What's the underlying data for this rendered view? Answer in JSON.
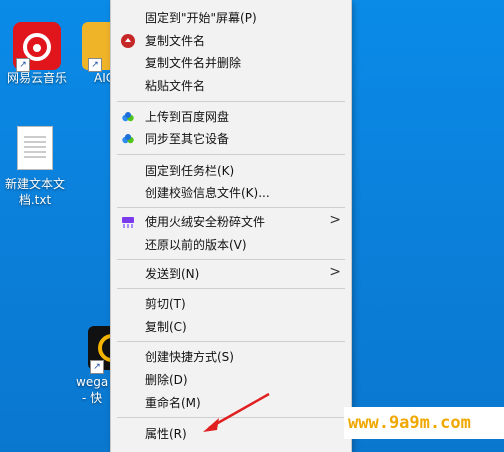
{
  "desktop": {
    "icons": [
      {
        "label": "网易云音乐"
      },
      {
        "label": "AIC"
      },
      {
        "label_line1": "新建文本文",
        "label_line2": "档.txt"
      },
      {
        "label_line1": "wega",
        "label_line2": "- 快"
      }
    ]
  },
  "context_menu": {
    "items": [
      {
        "label": "固定到\"开始\"屏幕(P)"
      },
      {
        "label": "复制文件名",
        "icon": "red-copy-icon"
      },
      {
        "label": "复制文件名并删除"
      },
      {
        "label": "粘贴文件名"
      },
      {
        "label": "上传到百度网盘",
        "icon": "baidu-cloud-icon"
      },
      {
        "label": "同步至其它设备",
        "icon": "baidu-cloud-icon"
      },
      {
        "label": "固定到任务栏(K)"
      },
      {
        "label": "创建校验信息文件(K)..."
      },
      {
        "label": "使用火绒安全粉碎文件",
        "icon": "huorong-shred-icon",
        "submenu": true
      },
      {
        "label": "还原以前的版本(V)"
      },
      {
        "label": "发送到(N)",
        "submenu": true
      },
      {
        "label": "剪切(T)"
      },
      {
        "label": "复制(C)"
      },
      {
        "label": "创建快捷方式(S)"
      },
      {
        "label": "删除(D)"
      },
      {
        "label": "重命名(M)"
      },
      {
        "label": "属性(R)"
      }
    ],
    "submenu_arrow": ">"
  },
  "watermark": {
    "text": "www.9a9m.com"
  },
  "colors": {
    "desktop": "#0b84e0",
    "menu_bg": "#f2f2f2",
    "arrow": "#e02020",
    "watermark": "#f0a800"
  }
}
